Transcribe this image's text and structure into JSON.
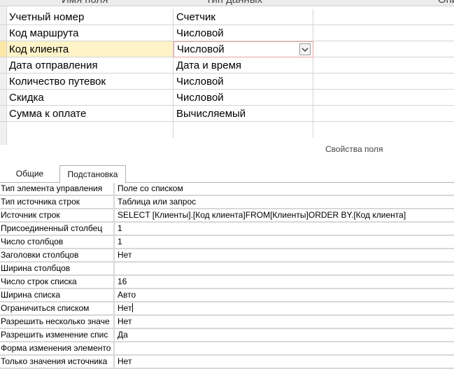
{
  "grid": {
    "headers": {
      "name": "Имя поля",
      "type": "Тип данных",
      "description": "Опи"
    },
    "rows": [
      {
        "name": "Учетный номер",
        "type": "Счетчик"
      },
      {
        "name": "Код маршрута",
        "type": "Числовой"
      },
      {
        "name": "Код клиента",
        "type": "Числовой"
      },
      {
        "name": "Дата отправления",
        "type": "Дата и время"
      },
      {
        "name": "Количество путевок",
        "type": "Числовой"
      },
      {
        "name": "Скидка",
        "type": "Числовой"
      },
      {
        "name": "Сумма к оплате",
        "type": "Вычисляемый"
      }
    ],
    "current_row_index": 2
  },
  "field_properties": {
    "caption": "Свойства поля"
  },
  "tabs": [
    {
      "label": "Общие",
      "active": false
    },
    {
      "label": "Подстановка",
      "active": true
    }
  ],
  "lookup_properties": [
    {
      "label": "Тип элемента управления",
      "value": "Поле со списком"
    },
    {
      "label": "Тип источника строк",
      "value": "Таблица или запрос"
    },
    {
      "label": "Источник строк",
      "value": "SELECT [Клиенты].[Код клиента]FROM[Клиенты]ORDER BY.[Код клиента]"
    },
    {
      "label": "Присоединенный столбец",
      "value": "1"
    },
    {
      "label": "Число столбцов",
      "value": "1"
    },
    {
      "label": "Заголовки столбцов",
      "value": "Нет"
    },
    {
      "label": "Ширина столбцов",
      "value": ""
    },
    {
      "label": "Число строк списка",
      "value": "16"
    },
    {
      "label": "Ширина списка",
      "value": "Авто"
    },
    {
      "label": "Ограничиться списком",
      "value": "Нет"
    },
    {
      "label": "Разрешить несколько значе",
      "value": "Нет"
    },
    {
      "label": "Разрешить изменение спис",
      "value": "Да"
    },
    {
      "label": "Форма изменения элементо",
      "value": ""
    },
    {
      "label": "Только значения источника",
      "value": "Нет"
    }
  ],
  "icons": {
    "dropdown": "chevron-down-icon"
  }
}
